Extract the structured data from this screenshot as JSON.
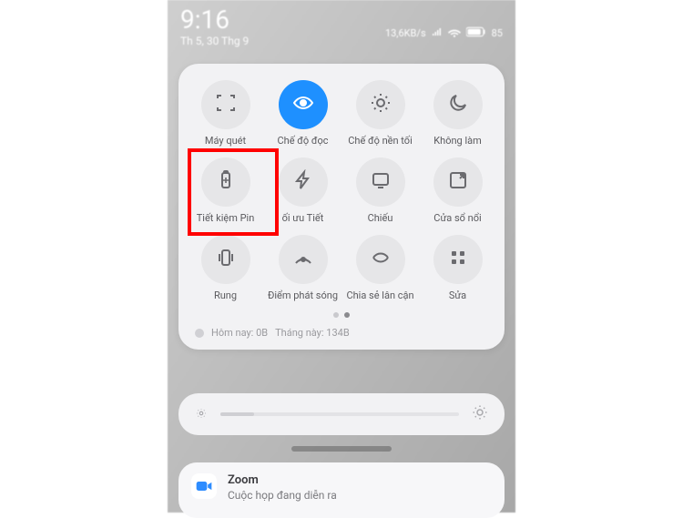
{
  "status": {
    "clock": "9:16",
    "date": "Th 5, 30 Thg 9",
    "speed": "13,6KB/s",
    "battery": "85"
  },
  "tiles": {
    "r1": [
      {
        "label": "Máy quét",
        "icon": "scanner",
        "active": false
      },
      {
        "label": "Chế độ đọc",
        "icon": "eye",
        "active": true
      },
      {
        "label": "Chế độ nền tối",
        "icon": "sun",
        "active": false
      },
      {
        "label": "Không làm",
        "icon": "moon",
        "active": false
      }
    ],
    "r2": [
      {
        "label": "Tiết kiệm Pin",
        "icon": "battery",
        "active": false
      },
      {
        "label": "ối ưu     Tiết",
        "icon": "bolt",
        "active": false
      },
      {
        "label": "Chiếu",
        "icon": "cast",
        "active": false
      },
      {
        "label": "Cửa sổ nổi",
        "icon": "popup",
        "active": false
      }
    ],
    "r3": [
      {
        "label": "Rung",
        "icon": "vibrate",
        "active": false
      },
      {
        "label": "Điểm phát sóng",
        "icon": "hotspot",
        "active": false
      },
      {
        "label": "Chia sẻ lân cận",
        "icon": "nearby",
        "active": false
      },
      {
        "label": "Sửa",
        "icon": "grid",
        "active": false
      }
    ]
  },
  "usage": {
    "today": "Hôm nay: 0B",
    "month": "Tháng này: 134B"
  },
  "notif": {
    "app": "Zoom",
    "body": "Cuộc họp đang diễn ra"
  },
  "highlight_tile": "battery"
}
